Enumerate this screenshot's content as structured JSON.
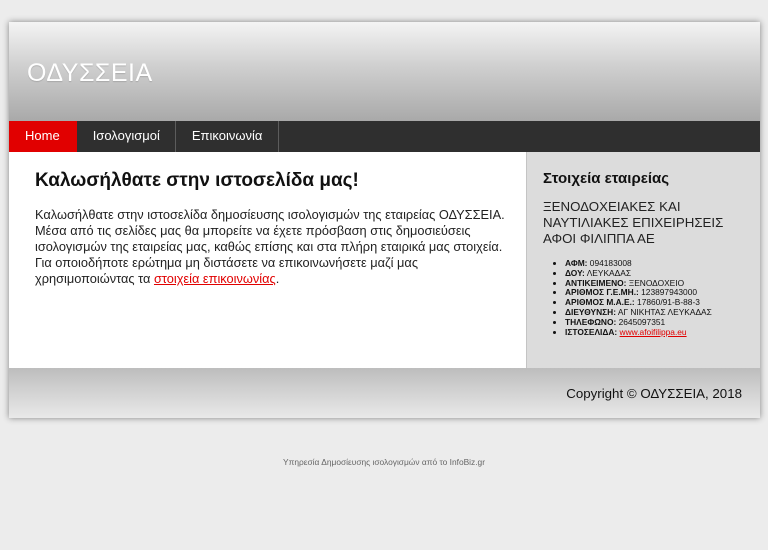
{
  "header": {
    "logo": "ΟΔΥΣΣΕΙΑ"
  },
  "nav": {
    "items": [
      {
        "label": "Home",
        "active": true
      },
      {
        "label": "Ισολογισμοί",
        "active": false
      },
      {
        "label": "Επικοινωνία",
        "active": false
      }
    ]
  },
  "main": {
    "title": "Καλωσήλθατε στην ιστοσελίδα μας!",
    "text_before_link": "Καλωσήλθατε στην ιστοσελίδα δημοσίευσης ισολογισμών της εταιρείας ΟΔΥΣΣΕΙΑ. Μέσα από τις σελίδες μας θα μπορείτε να έχετε πρόσβαση στις δημοσιεύσεις ισολογισμών της εταιρείας μας, καθώς επίσης και στα πλήρη εταιρικά μας στοιχεία. Για οποιοδήποτε ερώτημα μη διστάσετε να επικοινωνήσετε μαζί μας χρησιμοποιώντας τα ",
    "link_text": "στοιχεία επικοινωνίας",
    "text_after_link": "."
  },
  "sidebar": {
    "title": "Στοιχεία εταιρείας",
    "company_name": "ΞΕΝΟΔΟΧΕΙΑΚΕΣ ΚΑΙ ΝΑΥΤΙΛΙΑΚΕΣ ΕΠΙΧΕΙΡΗΣΕΙΣ ΑΦΟΙ ΦΙΛΙΠΠΑ ΑΕ",
    "details": [
      {
        "label": "ΑΦΜ:",
        "value": "094183008"
      },
      {
        "label": "ΔΟΥ:",
        "value": "ΛΕΥΚΑΔΑΣ"
      },
      {
        "label": "ΑΝΤΙΚΕΙΜΕΝΟ:",
        "value": "ΞΕΝΟΔΟΧΕΙΟ"
      },
      {
        "label": "ΑΡΙΘΜΟΣ Γ.Ε.ΜΗ.:",
        "value": "123897943000"
      },
      {
        "label": "ΑΡΙΘΜΟΣ Μ.Α.Ε.:",
        "value": "17860/91-Β-88-3"
      },
      {
        "label": "ΔΙΕΥΘΥΝΣΗ:",
        "value": "ΑΓ ΝΙΚΗΤΑΣ ΛΕΥΚΑΔΑΣ"
      },
      {
        "label": "ΤΗΛΕΦΩΝΟ:",
        "value": "2645097351"
      }
    ],
    "website": {
      "label": "ΙΣΤΟΣΕΛΙΔΑ:",
      "value": "www.afoifilippa.eu"
    }
  },
  "footer": {
    "copyright": "Copyright © ΟΔΥΣΣΕΙΑ, 2018"
  },
  "service_note": "Υπηρεσία Δημοσίευσης ισολογισμών από το InfoBiz.gr",
  "colors": {
    "accent": "#e10000",
    "nav_bg": "#2f2f2f",
    "sidebar_bg": "#dcdcdc"
  }
}
